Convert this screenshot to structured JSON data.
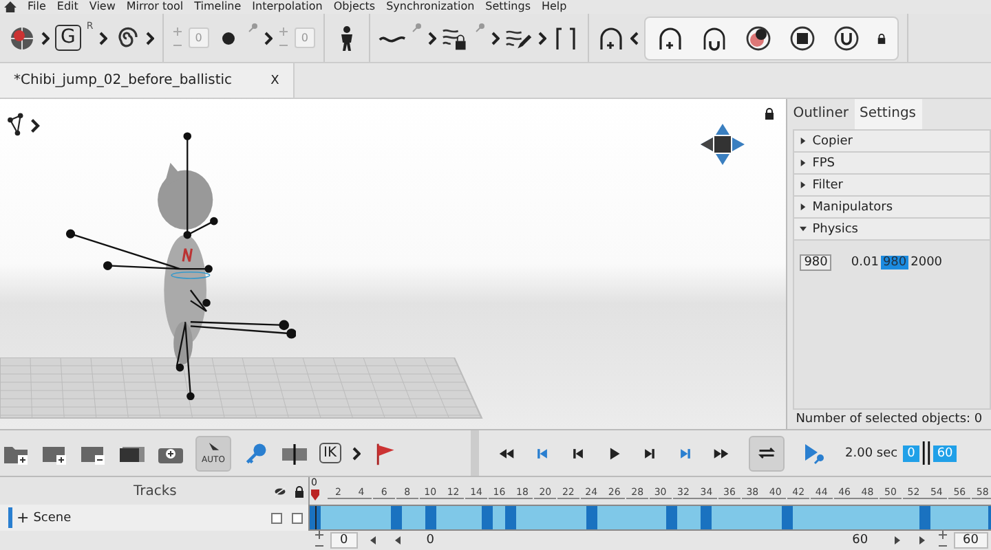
{
  "menu": [
    "File",
    "Edit",
    "View",
    "Mirror tool",
    "Timeline",
    "Interpolation",
    "Objects",
    "Synchronization",
    "Settings",
    "Help"
  ],
  "toolbar": {
    "g_label": "G",
    "r_mark": "R",
    "step_fields": [
      "0",
      "0"
    ]
  },
  "document_tab": {
    "title": "*Chibi_jump_02_before_ballistic",
    "close": "X"
  },
  "side_tabs": [
    {
      "label": "Outliner",
      "selected": false
    },
    {
      "label": "Settings",
      "selected": true
    }
  ],
  "sections": [
    {
      "label": "Copier",
      "expanded": false
    },
    {
      "label": "FPS",
      "expanded": false
    },
    {
      "label": "Filter",
      "expanded": false
    },
    {
      "label": "Manipulators",
      "expanded": false
    },
    {
      "label": "Physics",
      "expanded": true
    }
  ],
  "physics": {
    "value": "980",
    "min": "0.01",
    "current": "980",
    "max": "2000"
  },
  "status": "Number of selected objects: 0",
  "bottom_toolbar": {
    "auto_label": "AUTO",
    "auto_on": true,
    "ik_label": "IK",
    "loop_on": true,
    "duration": "2.00 sec",
    "range_start": "0",
    "range_end": "60"
  },
  "tracks": {
    "header": "Tracks",
    "scene": {
      "label": "Scene",
      "expand": "+",
      "visible": false,
      "locked": false
    }
  },
  "timeline": {
    "marker": "0",
    "ticks": [
      "2",
      "4",
      "6",
      "8",
      "10",
      "12",
      "14",
      "16",
      "18",
      "20",
      "22",
      "24",
      "26",
      "28",
      "30",
      "32",
      "34",
      "36",
      "38",
      "40",
      "42",
      "44",
      "46",
      "48",
      "50",
      "52",
      "54",
      "56",
      "58"
    ],
    "keyframes": [
      {
        "level": 0
      },
      {
        "level": 0.117
      },
      {
        "level": 0.167
      },
      {
        "level": 0.25
      },
      {
        "level": 0.283
      },
      {
        "level": 0.4
      },
      {
        "level": 0.517
      },
      {
        "level": 0.567
      },
      {
        "level": 0.683
      },
      {
        "level": 0.883
      },
      {
        "level": 0.983
      }
    ]
  },
  "footer": {
    "start_field": "0",
    "start_label": "0",
    "end_label": "60",
    "end_field": "60"
  }
}
